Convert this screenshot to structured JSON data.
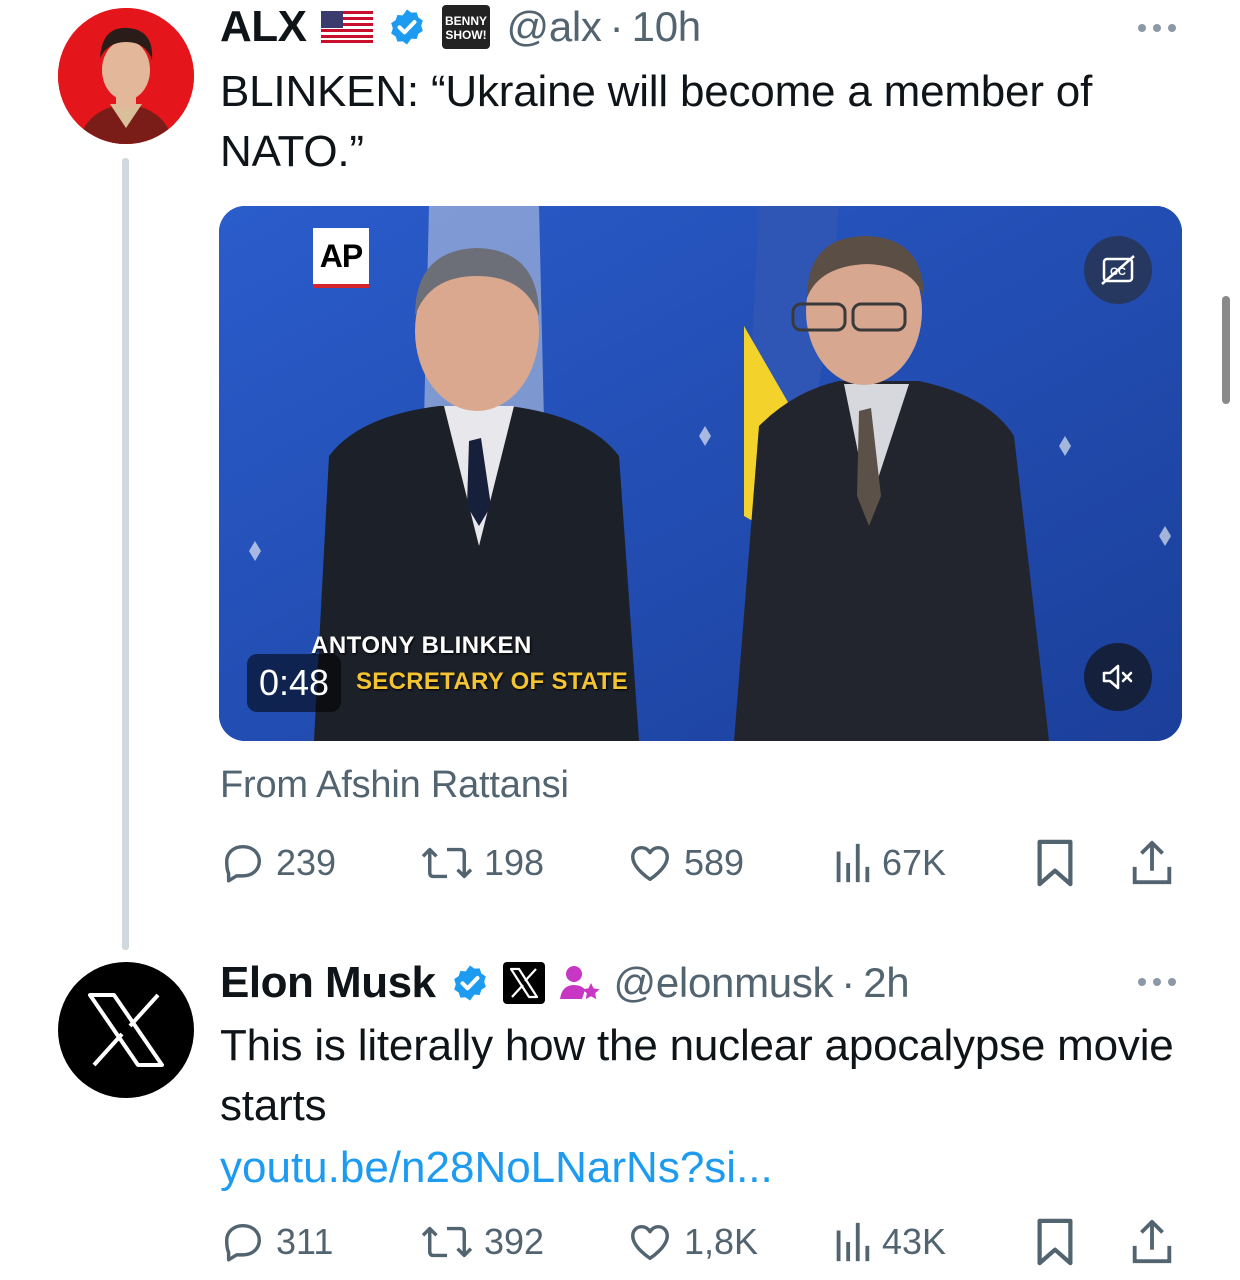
{
  "tweets": [
    {
      "author_name": "ALX",
      "handle": "@alx",
      "separator": "·",
      "time": "10h",
      "badges": [
        "us-flag-icon",
        "verified-badge-icon",
        "benny-show-badge"
      ],
      "badge_label": "BENNY SHOW!",
      "text": "BLINKEN: “Ukraine will become a member of NATO.”",
      "video": {
        "duration": "0:48",
        "overlay_logo": "AP",
        "lower_third_name": "ANTONY BLINKEN",
        "lower_third_title": "SECRETARY OF STATE"
      },
      "attribution": "From Afshin Rattansi",
      "stats": {
        "replies": "239",
        "reposts": "198",
        "likes": "589",
        "views": "67K"
      }
    },
    {
      "author_name": "Elon Musk",
      "handle": "@elonmusk",
      "separator": "·",
      "time": "2h",
      "badges": [
        "verified-badge-icon",
        "x-affiliate-badge-icon",
        "person-star-icon"
      ],
      "text": "This is literally how the nuclear apocalypse movie starts",
      "link": "youtu.be/n28NoLNarNs?si...",
      "stats": {
        "replies": "311",
        "reposts": "392",
        "likes": "1,8K",
        "views": "43K"
      }
    }
  ],
  "colors": {
    "accent_blue": "#1d9bf0",
    "text_primary": "#0f1419",
    "text_secondary": "#536471",
    "thread_line": "#cfd9de",
    "alx_avatar_bg": "#e4161b"
  }
}
